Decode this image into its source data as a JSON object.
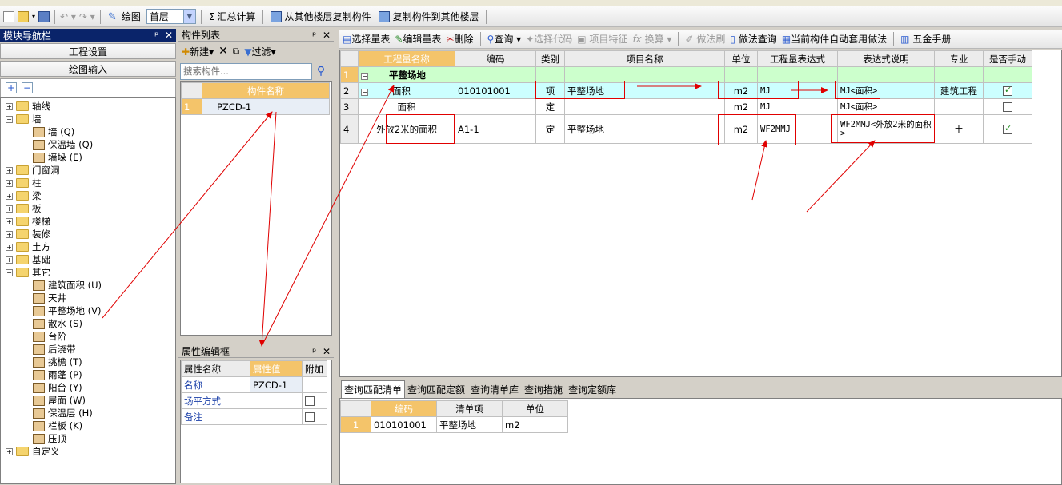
{
  "toolbar": {
    "draw_label": "绘图",
    "floor_value": "首层",
    "sum_label": "汇总计算",
    "copy_from_floor_label": "从其他楼层复制构件",
    "copy_to_floor_label": "复制构件到其他楼层"
  },
  "nav": {
    "title": "模块导航栏",
    "btn_project": "工程设置",
    "btn_draw": "绘图输入",
    "tree": [
      {
        "label": "轴线",
        "level": 0,
        "exp": "+"
      },
      {
        "label": "墙",
        "level": 0,
        "exp": "-"
      },
      {
        "label": "墙 (Q)",
        "level": 1
      },
      {
        "label": "保温墙 (Q)",
        "level": 1
      },
      {
        "label": "墙垛 (E)",
        "level": 1
      },
      {
        "label": "门窗洞",
        "level": 0,
        "exp": "+"
      },
      {
        "label": "柱",
        "level": 0,
        "exp": "+"
      },
      {
        "label": "梁",
        "level": 0,
        "exp": "+"
      },
      {
        "label": "板",
        "level": 0,
        "exp": "+"
      },
      {
        "label": "楼梯",
        "level": 0,
        "exp": "+"
      },
      {
        "label": "装修",
        "level": 0,
        "exp": "+"
      },
      {
        "label": "土方",
        "level": 0,
        "exp": "+"
      },
      {
        "label": "基础",
        "level": 0,
        "exp": "+"
      },
      {
        "label": "其它",
        "level": 0,
        "exp": "-"
      },
      {
        "label": "建筑面积 (U)",
        "level": 1
      },
      {
        "label": "天井",
        "level": 1
      },
      {
        "label": "平整场地 (V)",
        "level": 1
      },
      {
        "label": "散水 (S)",
        "level": 1
      },
      {
        "label": "台阶",
        "level": 1
      },
      {
        "label": "后浇带",
        "level": 1
      },
      {
        "label": "挑檐 (T)",
        "level": 1
      },
      {
        "label": "雨蓬 (P)",
        "level": 1
      },
      {
        "label": "阳台 (Y)",
        "level": 1
      },
      {
        "label": "屋面 (W)",
        "level": 1
      },
      {
        "label": "保温层 (H)",
        "level": 1
      },
      {
        "label": "栏板 (K)",
        "level": 1
      },
      {
        "label": "压顶",
        "level": 1
      },
      {
        "label": "自定义",
        "level": 0,
        "exp": "+"
      }
    ]
  },
  "component_list": {
    "title": "构件列表",
    "new_label": "新建",
    "filter_label": "过滤",
    "search_placeholder": "搜索构件...",
    "col_name": "构件名称",
    "rows": [
      {
        "num": "1",
        "name": "PZCD-1"
      }
    ]
  },
  "props": {
    "title": "属性编辑框",
    "col_name": "属性名称",
    "col_value": "属性值",
    "col_extra": "附加",
    "rows": [
      {
        "name": "名称",
        "value": "PZCD-1",
        "chk": false,
        "showchk": false
      },
      {
        "name": "场平方式",
        "value": "",
        "chk": false,
        "showchk": true
      },
      {
        "name": "备注",
        "value": "",
        "chk": false,
        "showchk": true
      }
    ]
  },
  "qty_toolbar": {
    "select_qty": "选择量表",
    "edit_qty": "编辑量表",
    "delete": "删除",
    "query": "查询",
    "select_code": "选择代码",
    "item_feature": "项目特征",
    "convert": "换算",
    "method_brush": "做法刷",
    "method_query": "做法查询",
    "auto_apply": "当前构件自动套用做法",
    "hardware_manual": "五金手册"
  },
  "qty_table": {
    "headers": [
      "工程量名称",
      "编码",
      "类别",
      "项目名称",
      "单位",
      "工程量表达式",
      "表达式说明",
      "专业",
      "是否手动"
    ],
    "rows": [
      {
        "num": "1",
        "name": "平整场地",
        "code": "",
        "type": "",
        "proj": "",
        "unit": "",
        "expr": "",
        "desc": "",
        "major": "",
        "manual": null
      },
      {
        "num": "2",
        "name": "面积",
        "code": "010101001",
        "type": "项",
        "proj": "平整场地",
        "unit": "m2",
        "expr": "MJ",
        "desc": "MJ<面积>",
        "major": "建筑工程",
        "manual": true
      },
      {
        "num": "3",
        "name": "面积",
        "code": "",
        "type": "定",
        "proj": "",
        "unit": "m2",
        "expr": "MJ",
        "desc": "MJ<面积>",
        "major": "",
        "manual": false
      },
      {
        "num": "4",
        "name": "外放2米的面积",
        "code": "A1-1",
        "type": "定",
        "proj": "平整场地",
        "unit": "m2",
        "expr": "WF2MMJ",
        "desc": "WF2MMJ<外放2米的面积>",
        "major": "土",
        "manual": true
      }
    ]
  },
  "bottom": {
    "tabs": [
      "查询匹配清单",
      "查询匹配定额",
      "查询清单库",
      "查询措施",
      "查询定额库"
    ],
    "headers": [
      "编码",
      "清单项",
      "单位"
    ],
    "rows": [
      {
        "num": "1",
        "code": "010101001",
        "item": "平整场地",
        "unit": "m2"
      }
    ]
  },
  "colors": {
    "accent": "#f4c46a",
    "title_bar": "#0a246a",
    "highlight_row": "#ccffff",
    "annotation": "#e00000"
  }
}
